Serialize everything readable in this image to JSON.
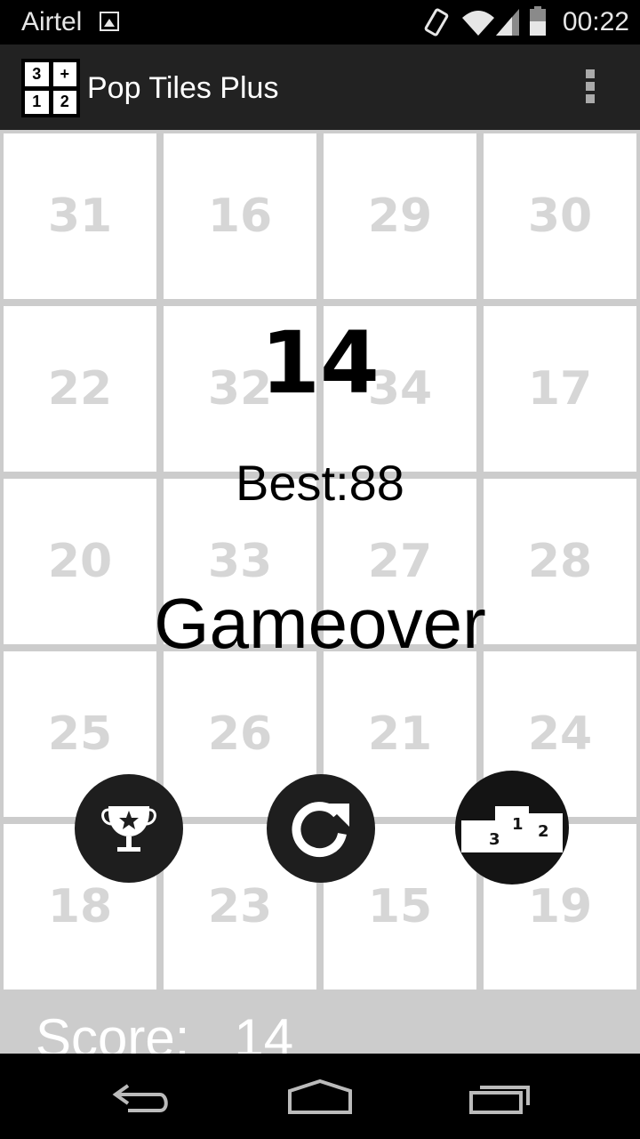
{
  "status_bar": {
    "carrier": "Airtel",
    "time": "00:22"
  },
  "action_bar": {
    "title": "Pop Tiles Plus",
    "app_icon_digits": [
      "3",
      "+",
      "1",
      "2"
    ]
  },
  "board": {
    "tiles": [
      [
        "31",
        "16",
        "29",
        "30"
      ],
      [
        "22",
        "32",
        "34",
        "17"
      ],
      [
        "20",
        "33",
        "27",
        "28"
      ],
      [
        "25",
        "26",
        "21",
        "24"
      ],
      [
        "18",
        "23",
        "15",
        "19"
      ]
    ]
  },
  "gameover_overlay": {
    "score": "14",
    "best": "Best:88",
    "message": "Gameover",
    "buttons": [
      {
        "name": "achievements-button",
        "icon": "trophy-star-icon"
      },
      {
        "name": "restart-button",
        "icon": "refresh-icon"
      },
      {
        "name": "leaderboard-button",
        "icon": "podium-icon"
      }
    ]
  },
  "score_bar": {
    "label": "Score:   14"
  },
  "colors": {
    "action_bar": "#222222",
    "board_gap": "#cccccc",
    "tile_text": "#d6d6d6",
    "button_bg": "#1e1e1e"
  }
}
